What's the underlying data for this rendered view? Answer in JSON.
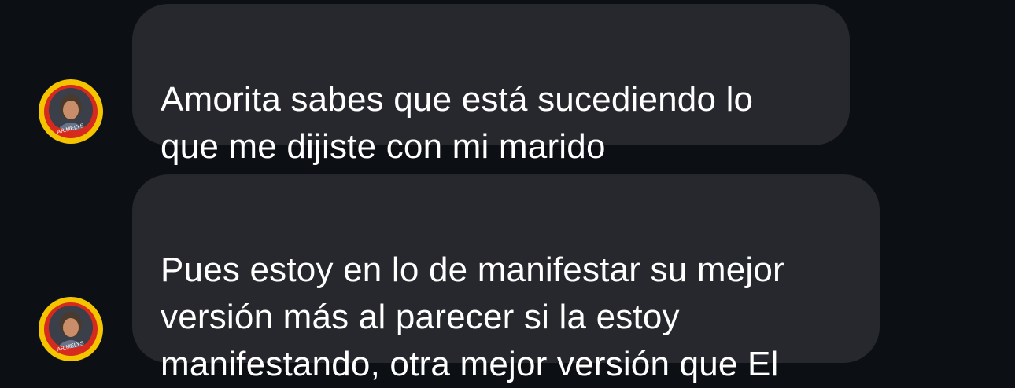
{
  "conversation": {
    "messages": [
      {
        "sender_avatar": {
          "badge_text": "AR.MELYS",
          "ring_color": "#f5c400",
          "inner_ring_color": "#d62a1e"
        },
        "text": "Amorita sabes que está sucediendo lo\nque me dijiste con mi marido"
      },
      {
        "sender_avatar": {
          "badge_text": "AR.MELYS",
          "ring_color": "#f5c400",
          "inner_ring_color": "#d62a1e"
        },
        "text": "Pues estoy en lo de manifestar su mejor\nversión más al parecer si la estoy\nmanifestando, otra mejor versión que El"
      }
    ]
  },
  "theme": {
    "background": "#0c0f13",
    "bubble_color": "#26282d",
    "text_color": "#ffffff"
  }
}
